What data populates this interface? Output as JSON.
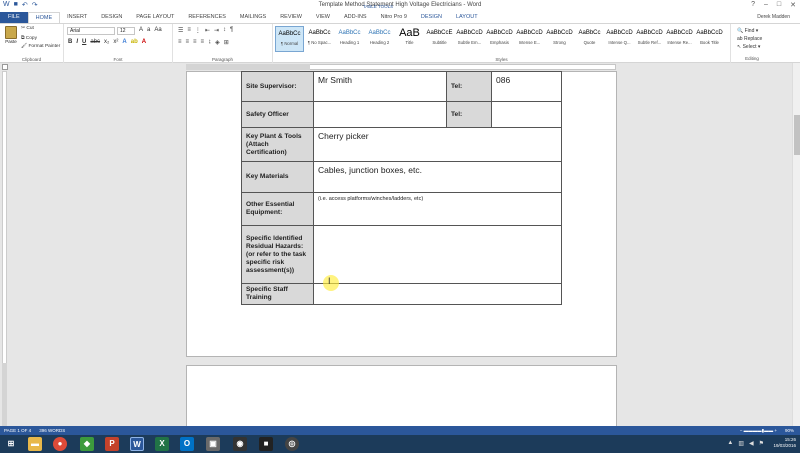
{
  "window": {
    "title": "Template Method Statement High Voltage Electricians - Word",
    "table_tools": "TABLE TOOLS",
    "user": "Derek Madden"
  },
  "tabs": [
    "FILE",
    "HOME",
    "INSERT",
    "DESIGN",
    "PAGE LAYOUT",
    "REFERENCES",
    "MAILINGS",
    "REVIEW",
    "VIEW",
    "ADD-INS",
    "Nitro Pro 9",
    "DESIGN",
    "LAYOUT"
  ],
  "clipboard": {
    "paste": "Paste",
    "cut": "Cut",
    "copy": "Copy",
    "format_painter": "Format Painter",
    "label": "Clipboard"
  },
  "font": {
    "name": "Arial",
    "size": "12",
    "label": "Font"
  },
  "paragraph": {
    "label": "Paragraph"
  },
  "styles": {
    "label": "Styles",
    "items": [
      {
        "preview": "AaBbCc",
        "name": "¶ Normal"
      },
      {
        "preview": "AaBbCc",
        "name": "¶ No Spac..."
      },
      {
        "preview": "AaBbCc",
        "name": "Heading 1"
      },
      {
        "preview": "AaBbCc",
        "name": "Heading 2"
      },
      {
        "preview": "AaB",
        "name": "Title"
      },
      {
        "preview": "AaBbCcE",
        "name": "Subtitle"
      },
      {
        "preview": "AaBbCcD",
        "name": "Subtle Em..."
      },
      {
        "preview": "AaBbCcD",
        "name": "Emphasis"
      },
      {
        "preview": "AaBbCcD",
        "name": "Intense E..."
      },
      {
        "preview": "AaBbCcD",
        "name": "Strong"
      },
      {
        "preview": "AaBbCc",
        "name": "Quote"
      },
      {
        "preview": "AaBbCcD",
        "name": "Intense Q..."
      },
      {
        "preview": "AaBbCcD",
        "name": "Subtle Ref..."
      },
      {
        "preview": "AaBbCcD",
        "name": "Intense Re..."
      },
      {
        "preview": "AaBbCcD",
        "name": "Book Title"
      }
    ]
  },
  "editing": {
    "find": "Find",
    "replace": "Replace",
    "select": "Select",
    "label": "Editing"
  },
  "table": {
    "site_supervisor_label": "Site Supervisor:",
    "site_supervisor_value": "Mr Smith",
    "tel_label": "Tel:",
    "tel_value": "086",
    "safety_officer_label": "Safety Officer",
    "key_plant_label": "Key Plant & Tools (Attach Certification)",
    "key_plant_value": "Cherry picker",
    "key_materials_label": "Key Materials",
    "key_materials_value": "Cables, junction boxes, etc.",
    "other_equipment_label": "Other Essential Equipment:",
    "other_equipment_value": "(i.e. access platforms/winches/ladders, etc)",
    "hazards_label": "Specific Identified Residual Hazards: (or refer to the task specific risk assessment(s))",
    "training_label": "Specific Staff Training"
  },
  "status": {
    "page": "PAGE 1 OF 4",
    "words": "396 WORDS",
    "zoom": "90%"
  },
  "clock": {
    "time": "15:26",
    "date": "19/03/2016"
  },
  "taskbar_icons": [
    "windows-start",
    "file-explorer",
    "chrome",
    "app-green",
    "powerpoint",
    "word",
    "excel",
    "outlook",
    "app-gray",
    "app-black",
    "app-globe"
  ]
}
